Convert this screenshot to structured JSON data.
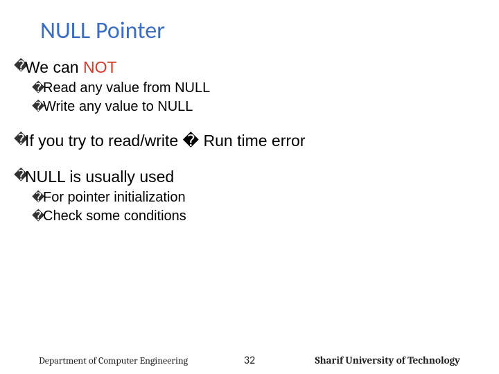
{
  "title": "NULL Pointer",
  "bullets": {
    "b1_prefix": "We can ",
    "b1_red": "NOT",
    "b1_sub1": "Read any value from NULL",
    "b1_sub2": "Write any value to NULL",
    "b2": "If you try to read/write � Run time error",
    "b3": "NULL is usually used",
    "b3_sub1": "For pointer initialization",
    "b3_sub2": "Check some conditions"
  },
  "footer": {
    "left": "Department of Computer Engineering",
    "page": "32",
    "right": "Sharif University of Technology"
  },
  "glyphs": {
    "bullet": "�"
  }
}
